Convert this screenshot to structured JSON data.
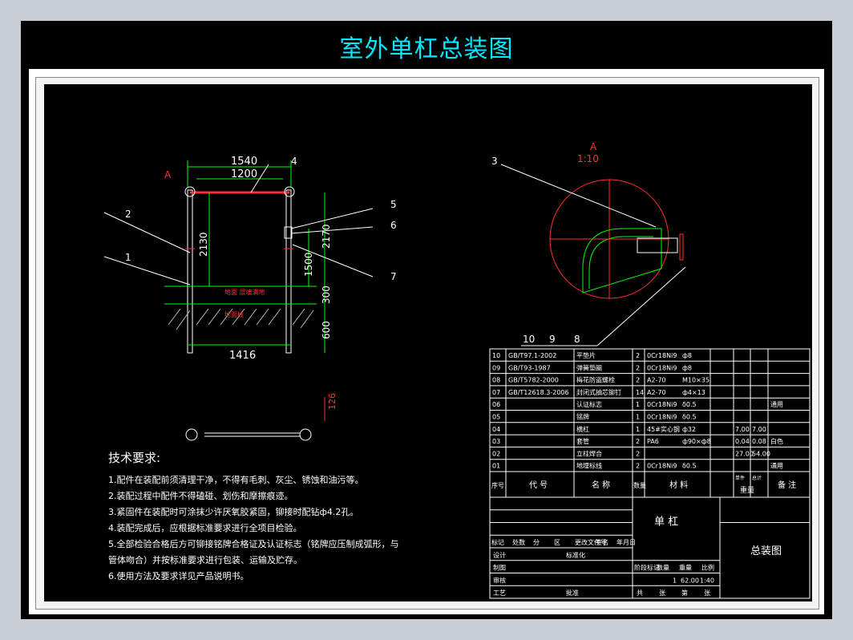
{
  "title": "室外单杠总装图",
  "colors": {
    "cyan": "#00e8ff",
    "green": "#00ff00",
    "red": "#ff2020",
    "yellow": "#ffff00",
    "white": "#ffffff"
  },
  "main_view": {
    "section_mark": "A",
    "dims": {
      "top_overall": "1540",
      "top_inner": "1200",
      "height_left": "2130",
      "height_right": "2170",
      "lower_right": "1500",
      "ground": "300",
      "buried": "600",
      "bottom_width": "1416"
    },
    "notes": {
      "upper": "地面 层填满地",
      "lower": "地面线"
    },
    "callouts": [
      "1",
      "2",
      "4",
      "5",
      "6",
      "7"
    ]
  },
  "detail_view": {
    "label": "A",
    "scale": "1:10",
    "callouts": [
      "3",
      "10",
      "9",
      "8"
    ]
  },
  "side_view": {
    "dim": "126"
  },
  "tech": {
    "heading": "技术要求:",
    "lines": [
      "1.配件在装配前须清理干净，不得有毛刺、灰尘、锈蚀和油污等。",
      "2.装配过程中配件不得磕碰、划伤和摩擦痕迹。",
      "3.紧固件在装配时可涂抹少许厌氧胶紧固，铆接时配钻ф4.2孔。",
      "4.装配完成后，应根据标准要求进行全项目检验。",
      "5.全部检验合格后方可铆接铭牌合格证及认证标志（铭牌应压制成弧形，与",
      "管体吻合）并按标准要求进行包装、运输及贮存。",
      "6.使用方法及要求详见产品说明书。"
    ]
  },
  "bom": {
    "rows": [
      {
        "no": "10",
        "code": "GB/T97.1-2002",
        "name": "平垫片",
        "qty": "2",
        "mat": "0Cr18Ni9",
        "spec": "ф8",
        "w1": "",
        "w2": "",
        "note": ""
      },
      {
        "no": "09",
        "code": "GB/T93-1987",
        "name": "弹簧垫圈",
        "qty": "2",
        "mat": "0Cr18Ni9",
        "spec": "ф8",
        "w1": "",
        "w2": "",
        "note": ""
      },
      {
        "no": "08",
        "code": "GB/T5782-2000",
        "name": "梅花防盗螺栓",
        "qty": "2",
        "mat": "A2-70",
        "spec": "M10×35",
        "w1": "",
        "w2": "",
        "note": ""
      },
      {
        "no": "07",
        "code": "GB/T12618.3-2006",
        "name": "封闭式抽芯铆钉",
        "qty": "14",
        "mat": "A2-70",
        "spec": "ф4×13",
        "w1": "",
        "w2": "",
        "note": ""
      },
      {
        "no": "06",
        "code": "",
        "name": "认证标志",
        "qty": "1",
        "mat": "0Cr18Ni9",
        "spec": "δ0.5",
        "w1": "",
        "w2": "",
        "note": "通用"
      },
      {
        "no": "05",
        "code": "",
        "name": "铭牌",
        "qty": "1",
        "mat": "0Cr18Ni9",
        "spec": "δ0.5",
        "w1": "",
        "w2": "",
        "note": ""
      },
      {
        "no": "04",
        "code": "",
        "name": "横杠",
        "qty": "1",
        "mat": "45#实心钢",
        "spec": "ф32",
        "w1": "7.00",
        "w2": "7.00",
        "note": ""
      },
      {
        "no": "03",
        "code": "",
        "name": "套管",
        "qty": "2",
        "mat": "PA6",
        "spec": "ф90×ф8",
        "w1": "0.04",
        "w2": "0.08",
        "note": "白色"
      },
      {
        "no": "02",
        "code": "",
        "name": "立柱焊合",
        "qty": "2",
        "mat": "",
        "spec": "",
        "w1": "27.00",
        "w2": "54.00",
        "note": ""
      },
      {
        "no": "01",
        "code": "",
        "name": "地埋标线",
        "qty": "2",
        "mat": "0Cr18Ni9",
        "spec": "δ0.5",
        "w1": "",
        "w2": "",
        "note": "通用"
      }
    ],
    "header": {
      "no": "序号",
      "code": "代  号",
      "name": "名  称",
      "qty": "数量",
      "mat": "材  料",
      "w1": "单件",
      "w2": "总计",
      "weight": "重量",
      "note": "备  注"
    }
  },
  "title_block": {
    "product": "单  杠",
    "drawing": "总装图",
    "rev_headers": [
      "标记",
      "处数",
      "分",
      "区",
      "更改文件号",
      "签名",
      "年月日"
    ],
    "roles": [
      "设计",
      "制图",
      "审核",
      "工艺"
    ],
    "standardize": "标准化",
    "approve": "批准",
    "stage_headers": [
      "阶段标记",
      "数量",
      "重量",
      "比例"
    ],
    "qty": "1",
    "weight": "62.00",
    "scale": "1:40",
    "sheets": [
      "共",
      "张",
      "第",
      "张"
    ]
  }
}
